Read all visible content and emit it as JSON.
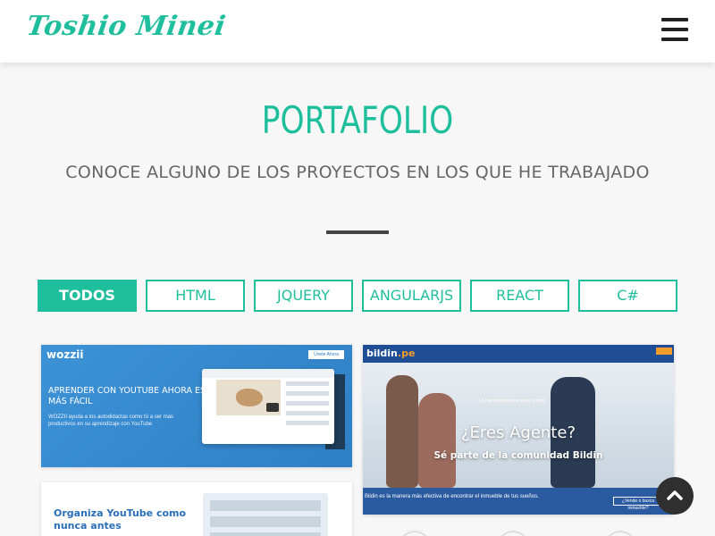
{
  "header": {
    "logo_text": "Toshio Minei",
    "menu_icon": "hamburger-menu-icon"
  },
  "section": {
    "title": "PORTAFOLIO",
    "subtitle": "CONOCE ALGUNO DE LOS PROYECTOS EN LOS QUE HE TRABAJADO"
  },
  "filters": [
    {
      "label": "TODOS",
      "active": true
    },
    {
      "label": "HTML",
      "active": false
    },
    {
      "label": "JQUERY",
      "active": false
    },
    {
      "label": "ANGULARJS",
      "active": false
    },
    {
      "label": "REACT",
      "active": false
    },
    {
      "label": "C#",
      "active": false
    }
  ],
  "projects": {
    "wozzii": {
      "logo": "wozzii",
      "cta": "Únete Ahora",
      "headline": "APRENDER CON YOUTUBE AHORA ES MÁS FÁCIL",
      "description": "WOZZII ayuda a los autodidactas como tú a ser más productivos en su aprendizaje con YouTube"
    },
    "bildin": {
      "logo_main": "bildin",
      "logo_accent": ".pe",
      "tagline": "La herramienta ideal para tu éxito",
      "title": "¿Eres Agente?",
      "subtitle": "Sé parte de la comunidad Bildin",
      "footer_text": "Bildin es la manera más efectiva de encontrar el inmueble de tus sueños.",
      "button": "¿Vende o busca inmueble?"
    },
    "organiza": {
      "title": "Organiza YouTube como nunca antes"
    }
  },
  "scroll_top": {
    "icon": "chevron-up-icon"
  },
  "colors": {
    "accent": "#1fbf9d",
    "text_muted": "#666666",
    "dark": "#2f2f2f"
  }
}
